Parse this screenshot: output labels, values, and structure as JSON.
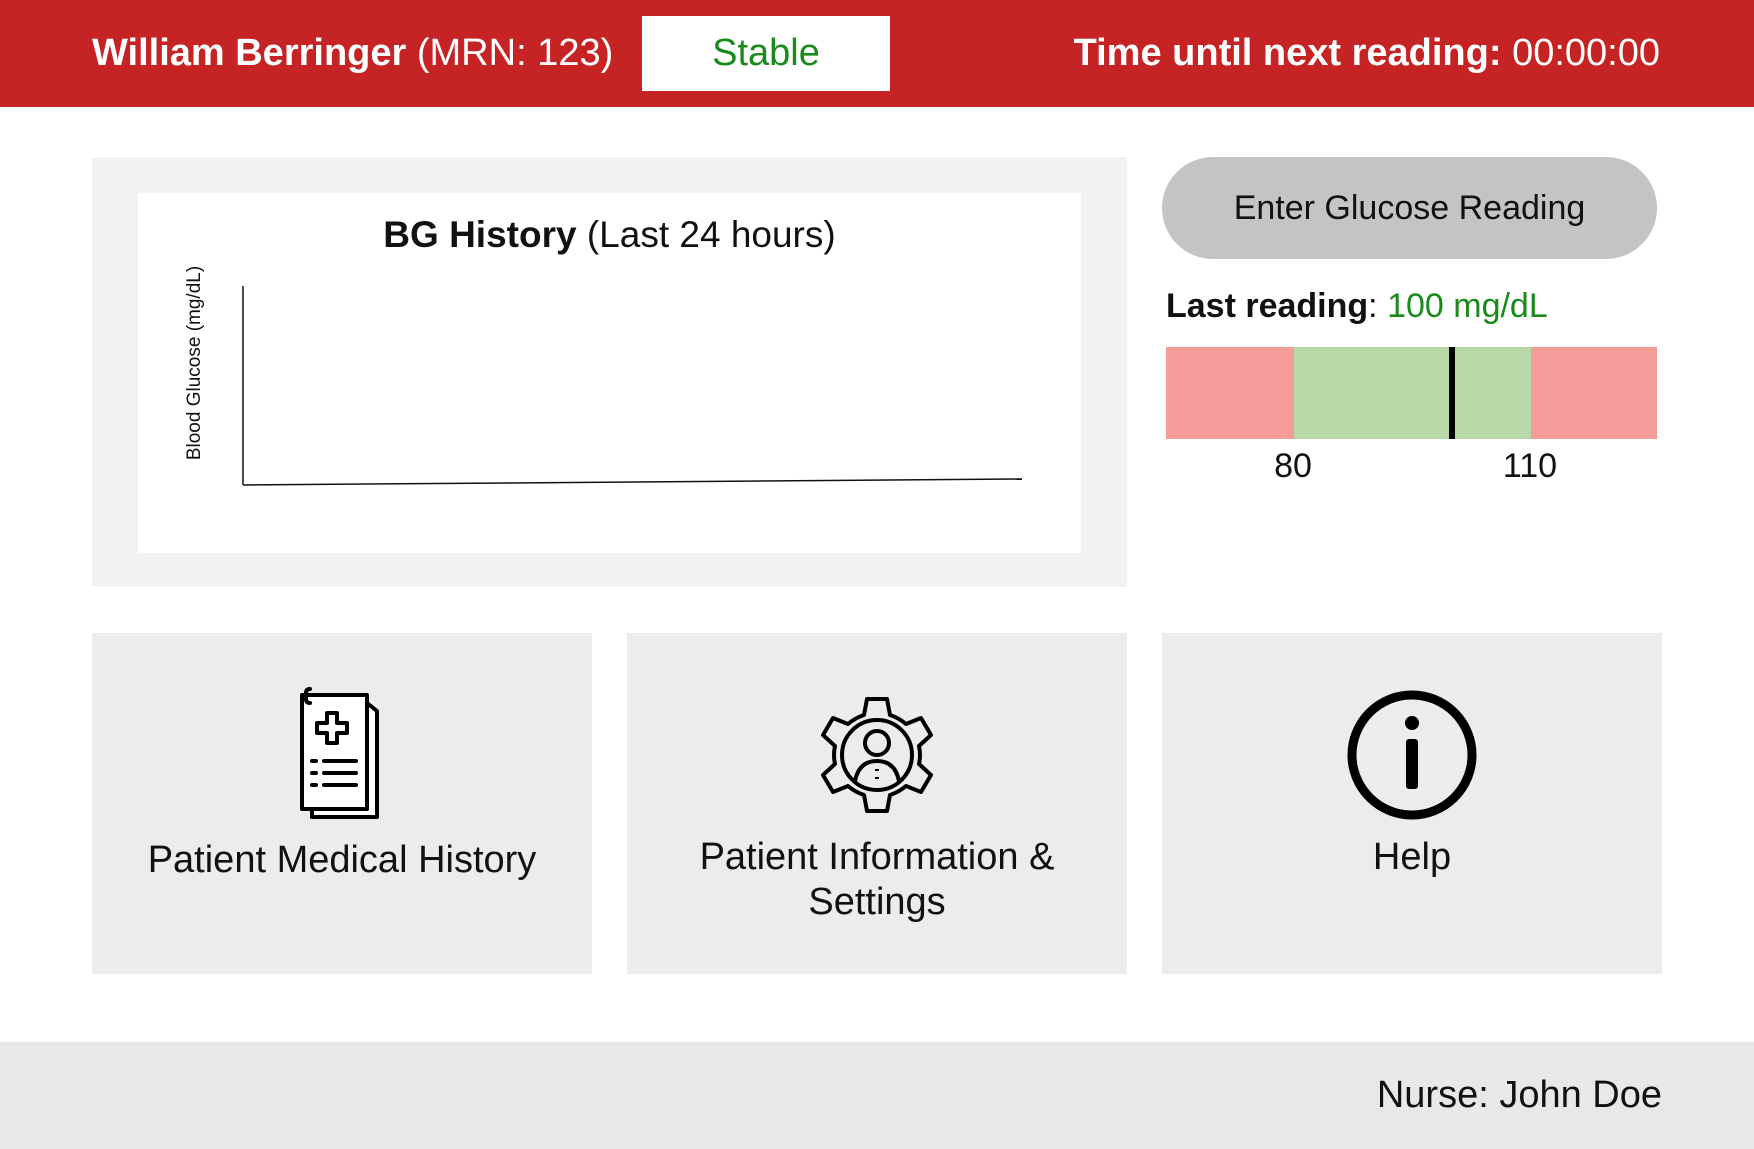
{
  "header": {
    "patient_name": "William Berringer",
    "mrn_text": "(MRN: 123)",
    "status": "Stable",
    "timer_label": "Time until next reading:",
    "timer_value": "00:00:00",
    "colors": {
      "bar": "#c62324",
      "status_text": "#1a8a1a"
    }
  },
  "chart": {
    "title_bold": "BG History",
    "title_rest": "(Last 24 hours)",
    "ylabel": "Blood Glucose (mg/dL)"
  },
  "chart_data": {
    "type": "line",
    "title": "BG History (Last 24 hours)",
    "xlabel": "",
    "ylabel": "Blood Glucose (mg/dL)",
    "series": [],
    "grid": false
  },
  "reading": {
    "button_label": "Enter Glucose Reading",
    "last_label": "Last reading",
    "separator": ":",
    "last_value": "100 mg/dL",
    "last_value_number": 100,
    "range_low": "80",
    "range_high": "110",
    "colors": {
      "out_of_range": "#f59c9a",
      "in_range": "#b8d8a8",
      "value_text": "#1a8a1a"
    }
  },
  "tiles": [
    {
      "label_line1": "Patient Medical History",
      "label_line2": "",
      "icon": "medical-record-icon"
    },
    {
      "label_line1": "Patient Information &",
      "label_line2": "Settings",
      "icon": "user-settings-gear-icon"
    },
    {
      "label_line1": "Help",
      "label_line2": "",
      "icon": "info-icon"
    }
  ],
  "footer": {
    "nurse": "Nurse: John Doe"
  }
}
